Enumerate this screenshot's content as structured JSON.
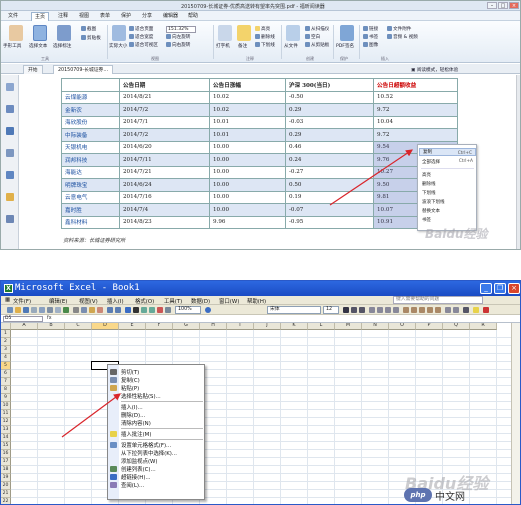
{
  "pdf": {
    "window_title": "20150709-长城证券-优质高送转有望率先突围.pdf - 福昕阅读器",
    "menu_tabs": [
      "文件",
      "主页",
      "注释",
      "视图",
      "表单",
      "保护",
      "分享",
      "编辑器",
      "帮助"
    ],
    "active_menu_tab": "主页",
    "ribbon": {
      "hand_tool": "手形工具",
      "select_text": "选择文本",
      "select_annot": "选择标注",
      "snapshot": "截图",
      "clipboard": "剪贴板",
      "zoom": "缩放",
      "actual_size": "实际大小",
      "fit_page": "适合页面",
      "fit_width": "适合宽度",
      "fit_visible": "适合可视区",
      "zoom_value": "151.32%",
      "rotate_left": "向左旋转",
      "rotate_right": "向右旋转",
      "typewriter": "打字机",
      "note": "备注",
      "highlight": "高亮",
      "strikeout": "删除线",
      "underline": "下划线",
      "from_file": "从文件",
      "from_scanner": "从扫描仪",
      "blank": "空白",
      "from_clipboard": "从剪贴板",
      "pdf_sign": "PDF签名",
      "link": "链接",
      "bookmark": "书签",
      "image": "图像",
      "file_attach": "文件附件",
      "audio_video": "音频 & 视频",
      "group_tools": "工具",
      "group_view": "视图",
      "group_comment": "注释",
      "group_create": "创建",
      "group_protect": "保护",
      "group_insert": "插入"
    },
    "doc_tabs": [
      "开始",
      "20150709-长城证券…"
    ],
    "notice": "阅读模式，轻松体验",
    "table": {
      "headers": [
        "",
        "公告日期",
        "公告日涨幅",
        "沪深 300(当日)",
        "公告日超额收益"
      ],
      "rows": [
        [
          "云煤能源",
          "2014/8/21",
          "10.02",
          "-0.50",
          "10.52"
        ],
        [
          "金新农",
          "2014/7/2",
          "10.02",
          "0.29",
          "9.72"
        ],
        [
          "海欣股份",
          "2014/7/1",
          "10.01",
          "-0.03",
          "10.04"
        ],
        [
          "中际装备",
          "2014/7/2",
          "10.01",
          "0.29",
          "9.72"
        ],
        [
          "天银机电",
          "2014/6/20",
          "10.00",
          "0.46",
          "9.54"
        ],
        [
          "润邦科技",
          "2014/7/11",
          "10.00",
          "0.24",
          "9.76"
        ],
        [
          "海能达",
          "2014/7/21",
          "10.00",
          "-0.27",
          "10.27"
        ],
        [
          "明牌珠宝",
          "2014/6/24",
          "10.00",
          "0.50",
          "9.50"
        ],
        [
          "云意电气",
          "2014/7/16",
          "10.00",
          "0.19",
          "9.81"
        ],
        [
          "嘉时胜",
          "2014/7/4",
          "10.00",
          "-0.07",
          "10.07"
        ],
        [
          "鑫科材料",
          "2014/8/23",
          "9.96",
          "-0.95",
          "10.91"
        ]
      ]
    },
    "source": "资料来源：长城证券研究所",
    "context_menu": [
      {
        "label": "复制",
        "shortcut": "Ctrl+C",
        "highlight": true
      },
      {
        "label": "全部选择",
        "shortcut": "Ctrl+A"
      },
      {
        "label": "高亮",
        "shortcut": ""
      },
      {
        "label": "删除线",
        "shortcut": ""
      },
      {
        "label": "下划线",
        "shortcut": ""
      },
      {
        "label": "波浪下划线",
        "shortcut": ""
      },
      {
        "label": "替换文本",
        "shortcut": ""
      },
      {
        "label": "书签",
        "shortcut": ""
      }
    ],
    "watermark": "Baidu经验"
  },
  "excel": {
    "window_title": "Microsoft Excel - Book1",
    "menus": [
      "文件(F)",
      "编辑(E)",
      "视图(V)",
      "插入(I)",
      "格式(O)",
      "工具(T)",
      "数据(D)",
      "窗口(W)",
      "帮助(H)"
    ],
    "help_placeholder": "键入需要帮助的问题",
    "zoom": "100%",
    "font": "宋体",
    "font_size": "12",
    "name_box": "D5",
    "fx": "fx",
    "columns": [
      "A",
      "B",
      "C",
      "D",
      "E",
      "F",
      "G",
      "H",
      "I",
      "J",
      "K",
      "L",
      "M",
      "N",
      "O",
      "P",
      "Q",
      "R"
    ],
    "rows": [
      "1",
      "2",
      "3",
      "4",
      "5",
      "6",
      "7",
      "8",
      "9",
      "10",
      "11",
      "12",
      "13",
      "14",
      "15",
      "16",
      "17",
      "18",
      "19",
      "20",
      "21",
      "22"
    ],
    "selected_column": "D",
    "selected_row": "5",
    "context_menu": [
      {
        "label": "剪切(T)",
        "icon": "scissors-icon"
      },
      {
        "label": "复制(C)",
        "icon": "copy-icon"
      },
      {
        "label": "粘贴(P)",
        "icon": "paste-icon"
      },
      {
        "label": "选择性粘贴(S)...",
        "icon": ""
      },
      {
        "divider": true
      },
      {
        "label": "插入(I)...",
        "icon": ""
      },
      {
        "label": "删除(D)...",
        "icon": ""
      },
      {
        "label": "清除内容(N)",
        "icon": ""
      },
      {
        "divider": true
      },
      {
        "label": "插入批注(M)",
        "icon": "comment-icon"
      },
      {
        "divider": true
      },
      {
        "label": "设置单元格格式(F)...",
        "icon": "format-icon"
      },
      {
        "label": "从下拉列表中选择(K)...",
        "icon": ""
      },
      {
        "label": "添加监视点(W)",
        "icon": ""
      },
      {
        "label": "创建列表(C)...",
        "icon": "list-icon"
      },
      {
        "label": "超链接(H)...",
        "icon": "link-icon"
      },
      {
        "label": "查阅(L)...",
        "icon": "lookup-icon"
      }
    ],
    "watermark": "Baidu经验",
    "php_logo": "php",
    "php_text": "中文网"
  },
  "colors": {
    "accent_red": "#cc0000",
    "link_blue": "#1a4fa0",
    "xp_title": "#2d68e0",
    "arrow": "#d9252b"
  }
}
